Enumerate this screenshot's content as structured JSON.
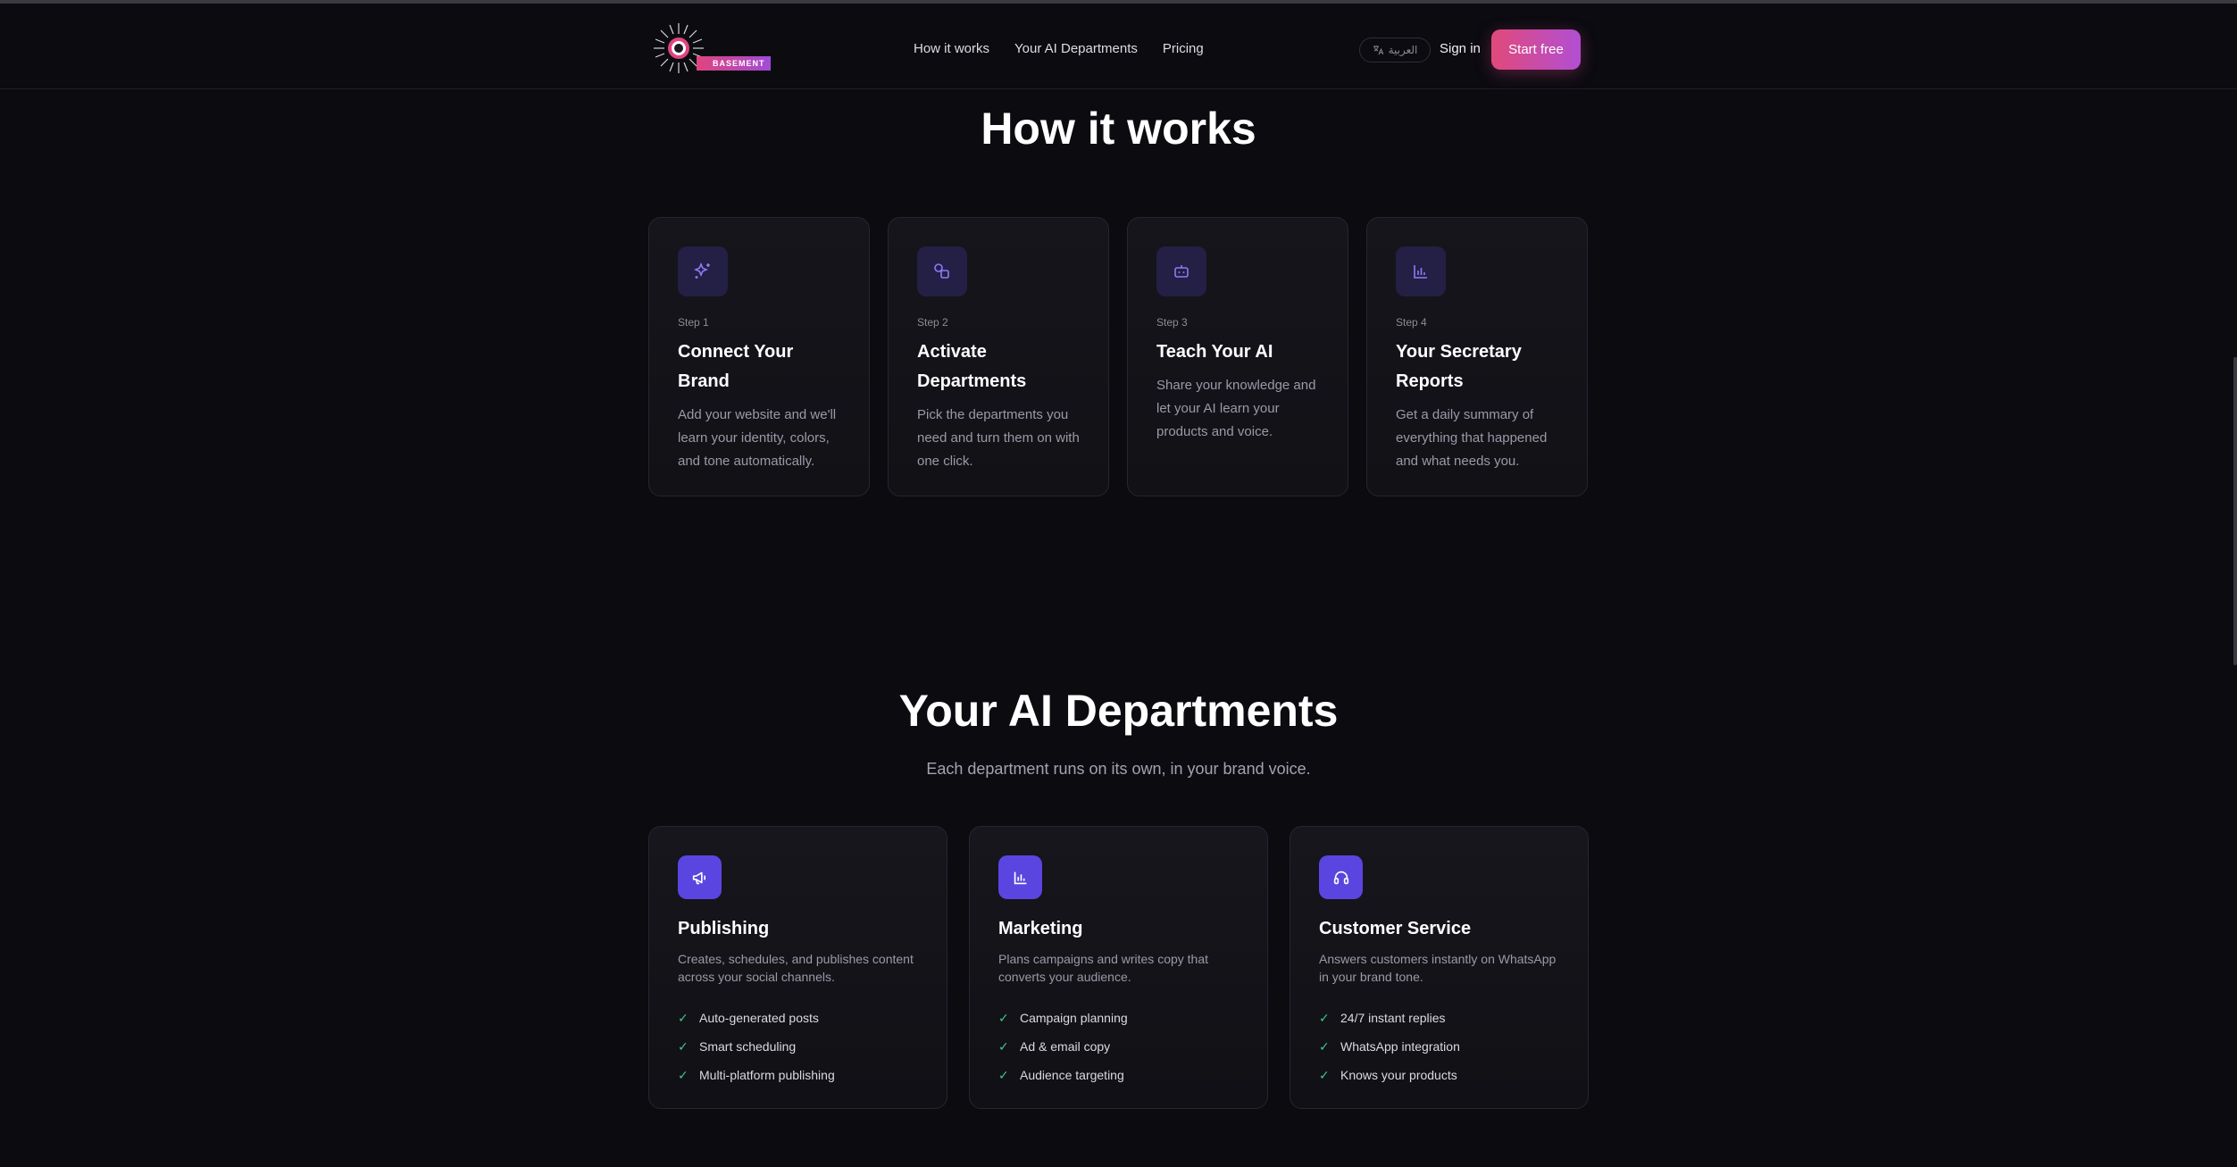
{
  "nav": {
    "logo_text": "BASEMENT",
    "links": [
      "How it works",
      "Your AI Departments",
      "Pricing"
    ],
    "language": "العربية",
    "signin": "Sign in",
    "cta": "Start free"
  },
  "how_it_works": {
    "title": "How it works",
    "steps": [
      {
        "label": "Step 1",
        "title": "Connect Your Brand",
        "desc": "Add your website and we'll learn your identity, colors, and tone automatically.",
        "icon": "sparkles-icon"
      },
      {
        "label": "Step 2",
        "title": "Activate Departments",
        "desc": "Pick the departments you need and turn them on with one click.",
        "icon": "shapes-icon"
      },
      {
        "label": "Step 3",
        "title": "Teach Your AI",
        "desc": "Share your knowledge and let your AI learn your products and voice.",
        "icon": "bot-icon"
      },
      {
        "label": "Step 4",
        "title": "Your Secretary Reports",
        "desc": "Get a daily summary of everything that happened and what needs you.",
        "icon": "bar-chart-icon"
      }
    ]
  },
  "departments": {
    "title": "Your AI Departments",
    "subtitle": "Each department runs on its own, in your brand voice.",
    "items": [
      {
        "name": "Publishing",
        "desc": "Creates, schedules, and publishes content across your social channels.",
        "icon": "megaphone-icon",
        "features": [
          "Auto-generated posts",
          "Smart scheduling",
          "Multi-platform publishing"
        ]
      },
      {
        "name": "Marketing",
        "desc": "Plans campaigns and writes copy that converts your audience.",
        "icon": "bar-chart-icon",
        "features": [
          "Campaign planning",
          "Ad & email copy",
          "Audience targeting"
        ]
      },
      {
        "name": "Customer Service",
        "desc": "Answers customers instantly on WhatsApp in your brand tone.",
        "icon": "headset-icon",
        "features": [
          "24/7 instant replies",
          "WhatsApp integration",
          "Knows your products"
        ]
      }
    ]
  },
  "colors": {
    "background": "#0b0b10",
    "accent_gradient_start": "#e2497a",
    "accent_gradient_end": "#b14fd3",
    "icon_tile": "#5b45e0",
    "check": "#3ec98a"
  }
}
